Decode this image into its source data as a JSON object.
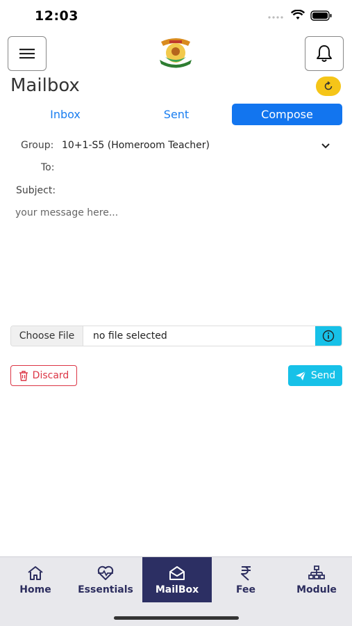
{
  "status_bar": {
    "time": "12:03"
  },
  "header": {
    "page_title": "Mailbox"
  },
  "tabs": [
    {
      "label": "Inbox"
    },
    {
      "label": "Sent"
    },
    {
      "label": "Compose"
    }
  ],
  "compose": {
    "group_label": "Group:",
    "group_value": "10+1-S5 (Homeroom Teacher)",
    "to_label": "To:",
    "subject_label": "Subject:",
    "message_placeholder": "your message here...",
    "choose_file_label": "Choose File",
    "file_name": "no file selected",
    "discard_label": "Discard",
    "send_label": "Send"
  },
  "bottom_nav": [
    {
      "label": "Home",
      "icon": "home-icon"
    },
    {
      "label": "Essentials",
      "icon": "heart-pulse-icon"
    },
    {
      "label": "MailBox",
      "icon": "mail-open-icon",
      "active": true
    },
    {
      "label": "Fee",
      "icon": "rupee-icon"
    },
    {
      "label": "Module",
      "icon": "sitemap-icon"
    }
  ],
  "colors": {
    "accent": "#1275ef",
    "refresh": "#f5c518",
    "info": "#17c1e8",
    "danger": "#dc3545",
    "nav_active": "#2c2f63"
  }
}
